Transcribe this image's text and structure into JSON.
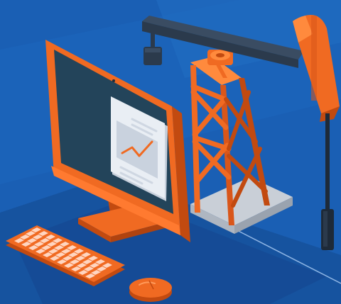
{
  "scene": {
    "subject": "monitor-with-chart-and-oil-pumpjack",
    "colors": {
      "background": "#1a5fb4",
      "background_light": "#2a74cc",
      "floor_dark": "#154a94",
      "accent_orange": "#f06a22",
      "orange_dark": "#c24a10",
      "orange_light": "#ff8a3d",
      "screen": "#23445a",
      "doc_card": "#e9eef4",
      "beam": "#2b3a4c",
      "concrete": "#d9dde3"
    },
    "icons": [
      "monitor-icon",
      "document-chart-icon",
      "keyboard-icon",
      "mouse-icon",
      "pumpjack-icon"
    ]
  }
}
